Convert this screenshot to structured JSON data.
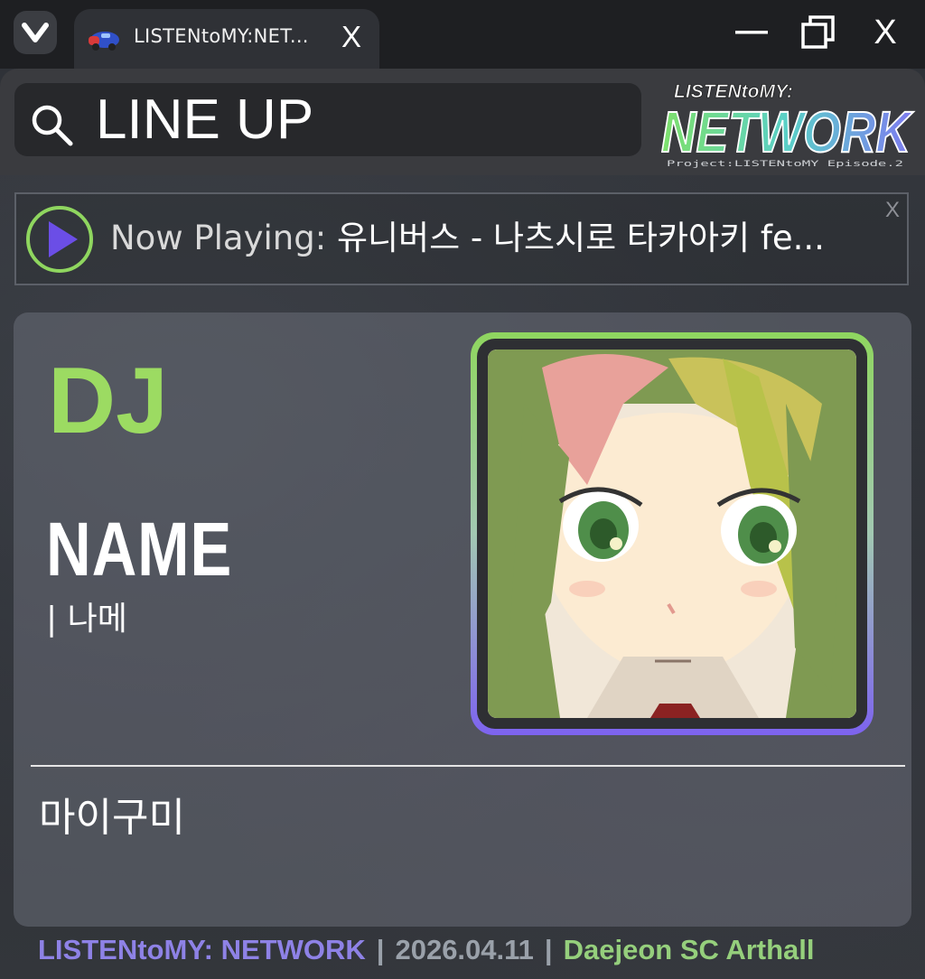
{
  "tab": {
    "title": "LISTENtoMY:NET...",
    "close_label": "X"
  },
  "window": {
    "close_label": "X"
  },
  "search": {
    "text": "LINE UP"
  },
  "logo": {
    "top": "LISTENtoMY:",
    "main": "NETWORK",
    "sub": "Project:LISTENtoMY Episode.2"
  },
  "now_playing": {
    "label": "Now Playing:",
    "track": "유니버스 - 나츠시로 타카아키 fe...",
    "close_label": "X"
  },
  "card": {
    "role": "DJ",
    "name": "NAME",
    "name_sub": "| 나메",
    "description": "마이구미"
  },
  "footer": {
    "brand": "LISTENtoMY: NETWORK",
    "sep1": "|",
    "date": "2026.04.11",
    "sep2": "|",
    "venue": "Daejeon SC Arthall"
  },
  "colors": {
    "role_green": "#9cdb62",
    "frame_top": "#8fd65f",
    "frame_bottom": "#7d63ef",
    "brand_purple": "#8e82e6",
    "venue_green": "#95cf7c"
  }
}
